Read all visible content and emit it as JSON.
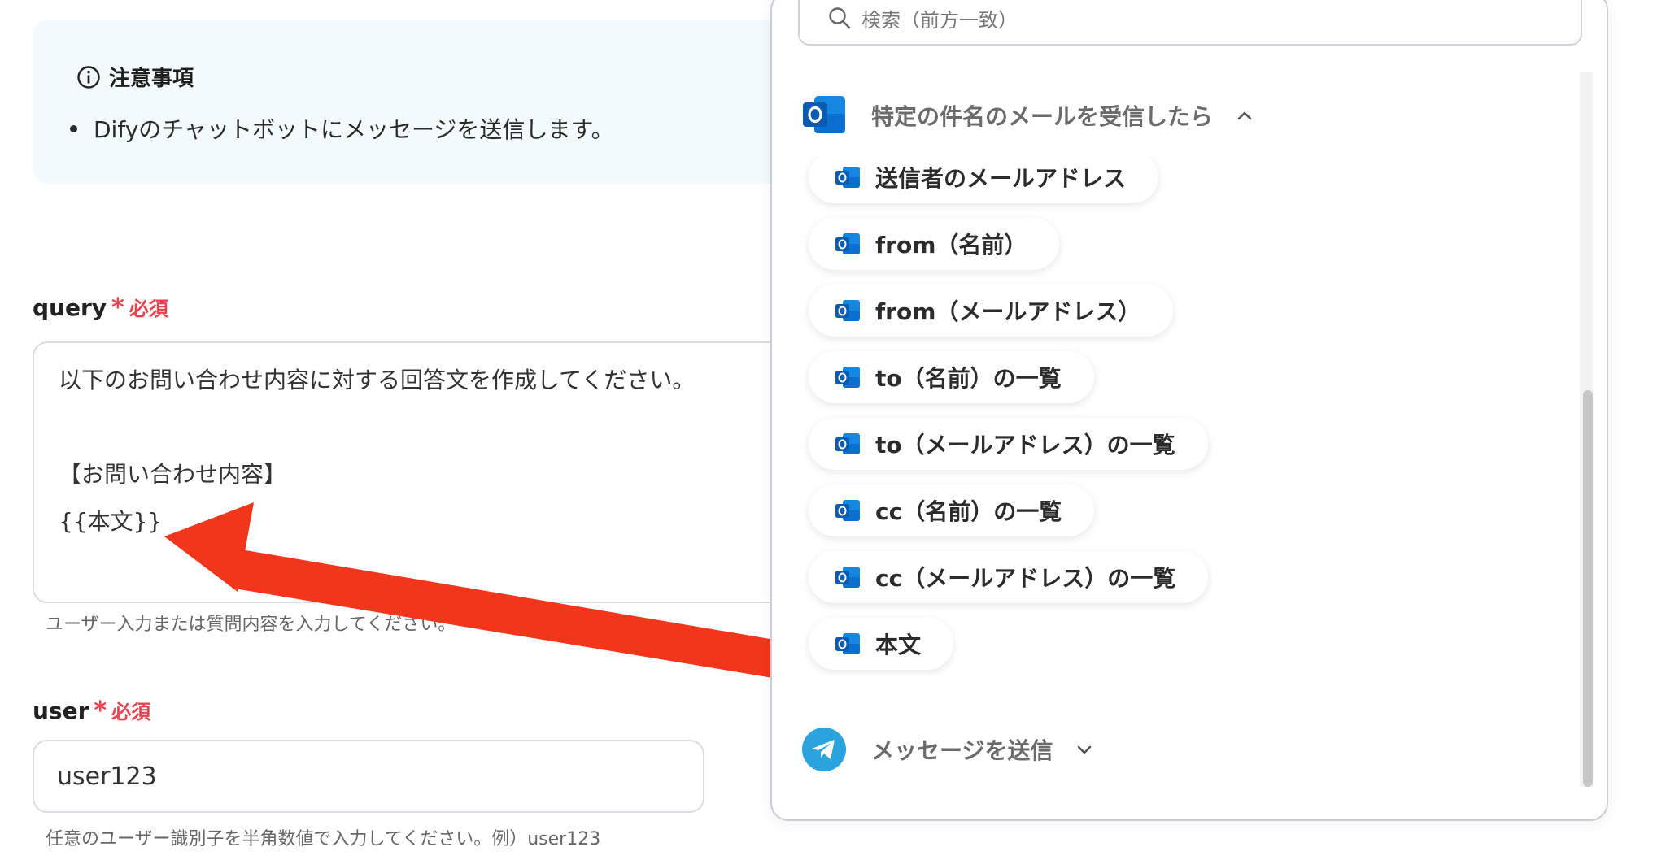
{
  "notice": {
    "title": "注意事項",
    "items": [
      "Difyのチャットボットにメッセージを送信します。"
    ]
  },
  "query_field": {
    "label": "query",
    "required_mark": "*",
    "required_text": "必須",
    "lines": [
      "以下のお問い合わせ内容に対する回答文を作成してください。",
      "",
      "【お問い合わせ内容】",
      "{{本文}}"
    ],
    "hint": "ユーザー入力または質問内容を入力してください。"
  },
  "user_field": {
    "label": "user",
    "required_mark": "*",
    "required_text": "必須",
    "value": "user123",
    "hint": "任意のユーザー識別子を半角数値で入力してください。例）user123"
  },
  "dropdown": {
    "search_placeholder": "検索（前方一致）",
    "groups": [
      {
        "title": "特定の件名のメールを受信したら",
        "icon": "outlook-icon",
        "expanded": true,
        "items": [
          "送信者のメールアドレス",
          "from（名前）",
          "from（メールアドレス）",
          "to（名前）の一覧",
          "to（メールアドレス）の一覧",
          "cc（名前）の一覧",
          "cc（メールアドレス）の一覧",
          "本文"
        ]
      },
      {
        "title": "メッセージを送信",
        "icon": "telegram-icon",
        "expanded": false
      }
    ]
  },
  "colors": {
    "required": "#e8434f",
    "notice_bg": "#f2fafa",
    "outlook_blue": "#0a6fd0",
    "telegram_blue": "#2aa3df",
    "arrow_red": "#f2361c"
  }
}
